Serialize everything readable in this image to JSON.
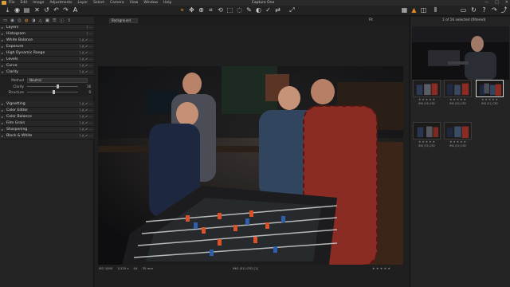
{
  "app": {
    "title": "Capture One"
  },
  "menu": [
    "File",
    "Edit",
    "Image",
    "Adjustments",
    "Layer",
    "Select",
    "Camera",
    "View",
    "Window",
    "Help"
  ],
  "window_controls": [
    "—",
    "□",
    "✕"
  ],
  "viewer": {
    "background_select": "Background",
    "zoom": "Fit",
    "iso": "ISO 1000",
    "shutter": "1/125 s",
    "aperture": "f/4",
    "focal": "35 mm",
    "filename": "IMG (51).CR2 [1]",
    "rating": "★ ★ ★ ★ ★"
  },
  "tools": [
    {
      "label": "Layers",
      "icons": "?  ⋯"
    },
    {
      "label": "Histogram",
      "icons": "?  ⋯"
    },
    {
      "label": "White Balance",
      "icons": "? A ↶ ⋯"
    },
    {
      "label": "Exposure",
      "icons": "? A ↶ ⋯"
    },
    {
      "label": "High Dynamic Range",
      "icons": "? A ↶ ⋯"
    },
    {
      "label": "Levels",
      "icons": "? A ↶ ⋯"
    },
    {
      "label": "Curve",
      "icons": "? A ↶ ⋯"
    },
    {
      "label": "Clarity",
      "icons": "? A ↶ ⋯"
    },
    {
      "label": "Vignetting",
      "icons": "? A ↶ ⋯"
    },
    {
      "label": "Color Editor",
      "icons": "? A ↶ ⋯"
    },
    {
      "label": "Color Balance",
      "icons": "? A ↶ ⋯"
    },
    {
      "label": "Film Grain",
      "icons": "? A ↶ ⋯"
    },
    {
      "label": "Sharpening",
      "icons": "? A ↶ ⋯"
    },
    {
      "label": "Black & White",
      "icons": "? A ↶ ⋯"
    }
  ],
  "clarity": {
    "method_label": "Method",
    "method_value": "Neutral",
    "clarity_label": "Clarity",
    "clarity_value": "16",
    "clarity_level": 0.58,
    "structure_label": "Structure",
    "structure_value": "0",
    "structure_level": 0.5
  },
  "browser": {
    "selection": "1 of 16 selected (filtered)",
    "thumbnails": [
      {
        "name": "IMG (34).CR2",
        "stars": "★ ★ ★ ★ ★",
        "selected": false
      },
      {
        "name": "IMG (50).CR2",
        "stars": "★ ★ ★ ★ ★",
        "selected": false
      },
      {
        "name": "IMG (51).CR2",
        "stars": "★ ★ ★ ★ ★",
        "selected": true
      },
      {
        "name": "IMG (35).CR2",
        "stars": "★ ★ ★ ★ ★",
        "selected": false
      },
      {
        "name": "IMG (52).CR2",
        "stars": "★ ★ ★ ★ ★",
        "selected": false
      }
    ]
  },
  "colors": {
    "accent": "#e08a2a",
    "panel": "#232323",
    "viewer": "#1f1f1f"
  }
}
